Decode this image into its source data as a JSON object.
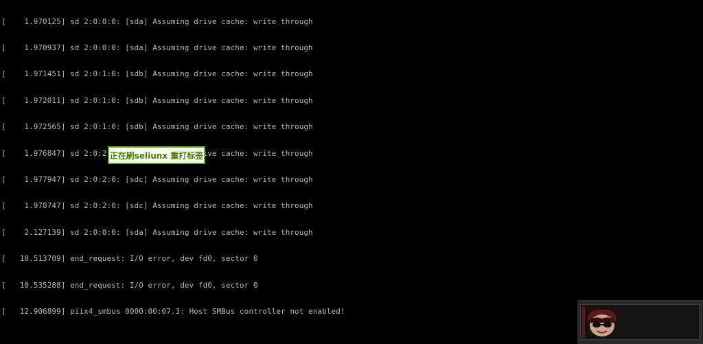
{
  "console": {
    "lines": [
      "[    1.970125] sd 2:0:0:0: [sda] Assuming drive cache: write through",
      "[    1.970937] sd 2:0:0:0: [sda] Assuming drive cache: write through",
      "[    1.971451] sd 2:0:1:0: [sdb] Assuming drive cache: write through",
      "[    1.972011] sd 2:0:1:0: [sdb] Assuming drive cache: write through",
      "[    1.972565] sd 2:0:1:0: [sdb] Assuming drive cache: write through",
      "[    1.976847] sd 2:0:2:0: [sdc] Assuming drive cache: write through",
      "[    1.977947] sd 2:0:2:0: [sdc] Assuming drive cache: write through",
      "[    1.978747] sd 2:0:2:0: [sdc] Assuming drive cache: write through",
      "[    2.127139] sd 2:0:0:0: [sda] Assuming drive cache: write through",
      "[   10.513709] end_request: I/O error, dev fd0, sector 0",
      "[   10.535288] end_request: I/O error, dev fd0, sector 0",
      "[   12.906899] piix4_smbus 0000:00:07.3: Host SMBus controller not enabled!"
    ]
  },
  "annotation": {
    "label": "正在刷seliunx 重打标签"
  },
  "watermark": {
    "icon": "avatar-sunglasses-icon"
  },
  "colors": {
    "background": "#000000",
    "console_text": "#b8b8b8",
    "annotation_border": "#6c9e2a",
    "annotation_text": "#4a7d12"
  }
}
